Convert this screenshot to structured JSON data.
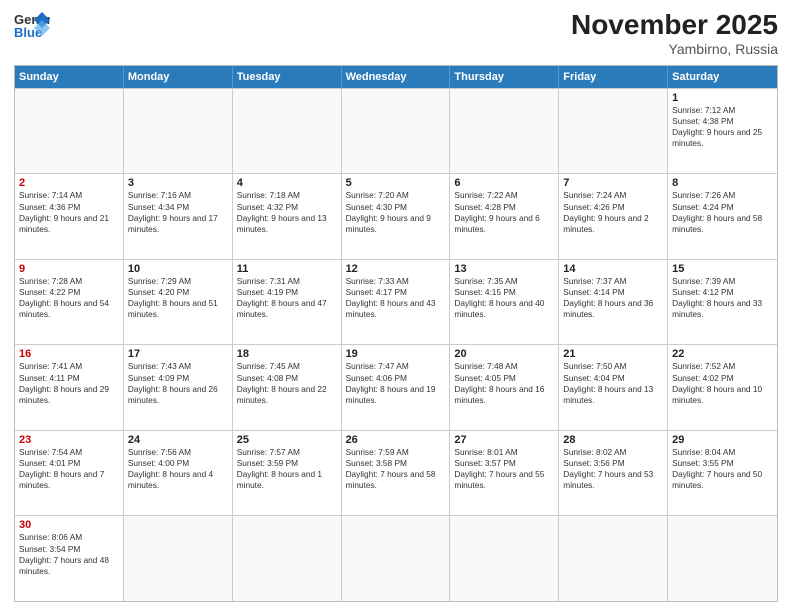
{
  "header": {
    "logo_general": "General",
    "logo_blue": "Blue",
    "title": "November 2025",
    "subtitle": "Yambirno, Russia"
  },
  "days_of_week": [
    "Sunday",
    "Monday",
    "Tuesday",
    "Wednesday",
    "Thursday",
    "Friday",
    "Saturday"
  ],
  "rows": [
    [
      {
        "day": "",
        "empty": true
      },
      {
        "day": "",
        "empty": true
      },
      {
        "day": "",
        "empty": true
      },
      {
        "day": "",
        "empty": true
      },
      {
        "day": "",
        "empty": true
      },
      {
        "day": "",
        "empty": true
      },
      {
        "day": "1",
        "rise": "7:12 AM",
        "set": "4:38 PM",
        "daylight": "9 hours and 25 minutes."
      }
    ],
    [
      {
        "day": "2",
        "rise": "7:14 AM",
        "set": "4:36 PM",
        "daylight": "9 hours and 21 minutes."
      },
      {
        "day": "3",
        "rise": "7:16 AM",
        "set": "4:34 PM",
        "daylight": "9 hours and 17 minutes."
      },
      {
        "day": "4",
        "rise": "7:18 AM",
        "set": "4:32 PM",
        "daylight": "9 hours and 13 minutes."
      },
      {
        "day": "5",
        "rise": "7:20 AM",
        "set": "4:30 PM",
        "daylight": "9 hours and 9 minutes."
      },
      {
        "day": "6",
        "rise": "7:22 AM",
        "set": "4:28 PM",
        "daylight": "9 hours and 6 minutes."
      },
      {
        "day": "7",
        "rise": "7:24 AM",
        "set": "4:26 PM",
        "daylight": "9 hours and 2 minutes."
      },
      {
        "day": "8",
        "rise": "7:26 AM",
        "set": "4:24 PM",
        "daylight": "8 hours and 58 minutes."
      }
    ],
    [
      {
        "day": "9",
        "rise": "7:28 AM",
        "set": "4:22 PM",
        "daylight": "8 hours and 54 minutes."
      },
      {
        "day": "10",
        "rise": "7:29 AM",
        "set": "4:20 PM",
        "daylight": "8 hours and 51 minutes."
      },
      {
        "day": "11",
        "rise": "7:31 AM",
        "set": "4:19 PM",
        "daylight": "8 hours and 47 minutes."
      },
      {
        "day": "12",
        "rise": "7:33 AM",
        "set": "4:17 PM",
        "daylight": "8 hours and 43 minutes."
      },
      {
        "day": "13",
        "rise": "7:35 AM",
        "set": "4:15 PM",
        "daylight": "8 hours and 40 minutes."
      },
      {
        "day": "14",
        "rise": "7:37 AM",
        "set": "4:14 PM",
        "daylight": "8 hours and 36 minutes."
      },
      {
        "day": "15",
        "rise": "7:39 AM",
        "set": "4:12 PM",
        "daylight": "8 hours and 33 minutes."
      }
    ],
    [
      {
        "day": "16",
        "rise": "7:41 AM",
        "set": "4:11 PM",
        "daylight": "8 hours and 29 minutes."
      },
      {
        "day": "17",
        "rise": "7:43 AM",
        "set": "4:09 PM",
        "daylight": "8 hours and 26 minutes."
      },
      {
        "day": "18",
        "rise": "7:45 AM",
        "set": "4:08 PM",
        "daylight": "8 hours and 22 minutes."
      },
      {
        "day": "19",
        "rise": "7:47 AM",
        "set": "4:06 PM",
        "daylight": "8 hours and 19 minutes."
      },
      {
        "day": "20",
        "rise": "7:48 AM",
        "set": "4:05 PM",
        "daylight": "8 hours and 16 minutes."
      },
      {
        "day": "21",
        "rise": "7:50 AM",
        "set": "4:04 PM",
        "daylight": "8 hours and 13 minutes."
      },
      {
        "day": "22",
        "rise": "7:52 AM",
        "set": "4:02 PM",
        "daylight": "8 hours and 10 minutes."
      }
    ],
    [
      {
        "day": "23",
        "rise": "7:54 AM",
        "set": "4:01 PM",
        "daylight": "8 hours and 7 minutes."
      },
      {
        "day": "24",
        "rise": "7:56 AM",
        "set": "4:00 PM",
        "daylight": "8 hours and 4 minutes."
      },
      {
        "day": "25",
        "rise": "7:57 AM",
        "set": "3:59 PM",
        "daylight": "8 hours and 1 minute."
      },
      {
        "day": "26",
        "rise": "7:59 AM",
        "set": "3:58 PM",
        "daylight": "7 hours and 58 minutes."
      },
      {
        "day": "27",
        "rise": "8:01 AM",
        "set": "3:57 PM",
        "daylight": "7 hours and 55 minutes."
      },
      {
        "day": "28",
        "rise": "8:02 AM",
        "set": "3:56 PM",
        "daylight": "7 hours and 53 minutes."
      },
      {
        "day": "29",
        "rise": "8:04 AM",
        "set": "3:55 PM",
        "daylight": "7 hours and 50 minutes."
      }
    ],
    [
      {
        "day": "30",
        "rise": "8:06 AM",
        "set": "3:54 PM",
        "daylight": "7 hours and 48 minutes."
      },
      {
        "day": "",
        "empty": true
      },
      {
        "day": "",
        "empty": true
      },
      {
        "day": "",
        "empty": true
      },
      {
        "day": "",
        "empty": true
      },
      {
        "day": "",
        "empty": true
      },
      {
        "day": "",
        "empty": true
      }
    ]
  ]
}
